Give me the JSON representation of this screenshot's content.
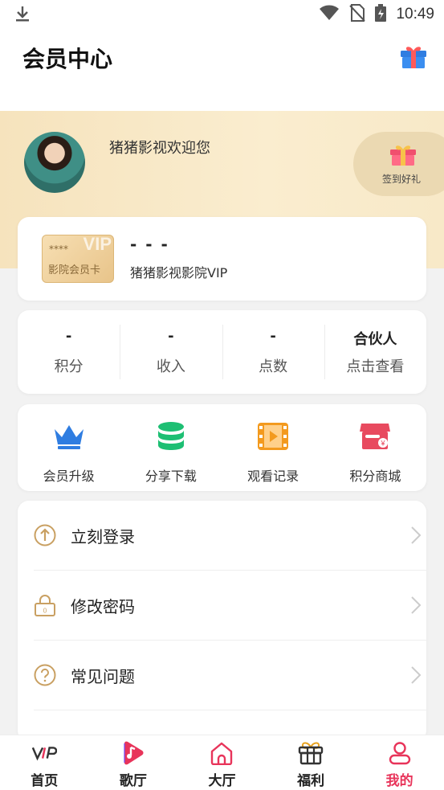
{
  "status_bar": {
    "time": "10:49"
  },
  "header": {
    "title": "会员中心",
    "gift_icon": "gift-icon"
  },
  "profile": {
    "greeting": "猪猪影视欢迎您",
    "checkin_label": "签到好礼"
  },
  "vip_card": {
    "badge_stars": "****",
    "badge_vip": "VIP",
    "badge_label": "影院会员卡",
    "name": "- - -",
    "subtitle": "猪猪影视影院VIP"
  },
  "stats": [
    {
      "value": "-",
      "label": "积分"
    },
    {
      "value": "-",
      "label": "收入"
    },
    {
      "value": "-",
      "label": "点数"
    },
    {
      "value": "合伙人",
      "label": "点击查看"
    }
  ],
  "shortcuts": [
    {
      "label": "会员升级",
      "icon": "crown-icon",
      "color": "#2f7de1"
    },
    {
      "label": "分享下载",
      "icon": "database-icon",
      "color": "#1dbf73"
    },
    {
      "label": "观看记录",
      "icon": "film-icon",
      "color": "#f39a1e"
    },
    {
      "label": "积分商城",
      "icon": "shop-icon",
      "color": "#e84a5f"
    }
  ],
  "menu": [
    {
      "label": "立刻登录",
      "icon": "login-icon"
    },
    {
      "label": "修改密码",
      "icon": "lock-icon"
    },
    {
      "label": "常见问题",
      "icon": "question-icon"
    }
  ],
  "tabbar": [
    {
      "label": "首页",
      "icon": "vip-icon"
    },
    {
      "label": "歌厅",
      "icon": "music-icon"
    },
    {
      "label": "大厅",
      "icon": "home-icon"
    },
    {
      "label": "福利",
      "icon": "gift-icon"
    },
    {
      "label": "我的",
      "icon": "user-icon",
      "active": true
    }
  ],
  "colors": {
    "accent": "#e8345a",
    "gold": "#c9a062",
    "banner": "#f6e3bd"
  }
}
